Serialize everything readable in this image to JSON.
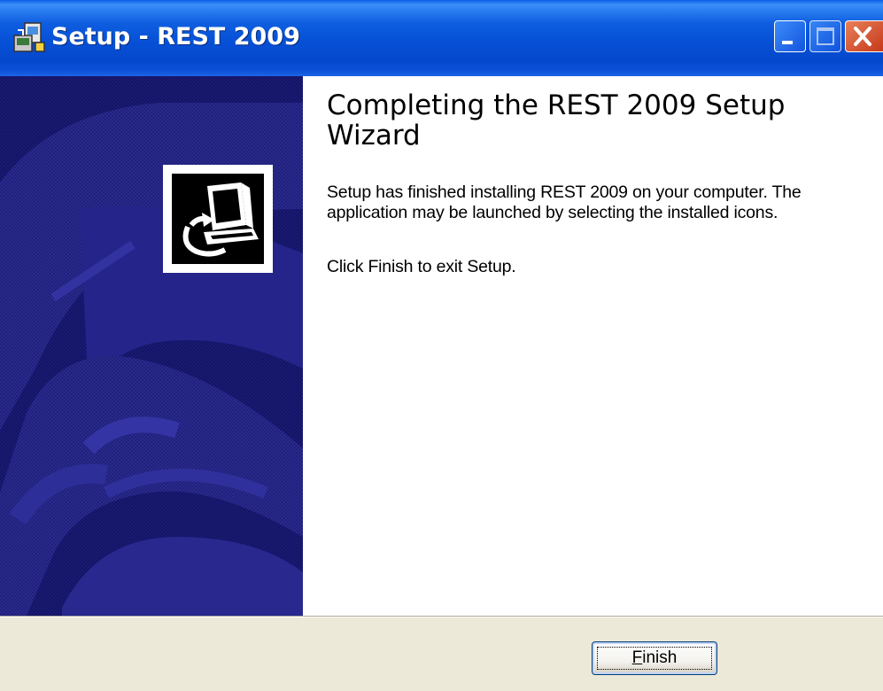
{
  "window": {
    "title": "Setup - REST 2009",
    "icon": "setup-installer-icon",
    "controls": [
      "minimize-icon",
      "maximize-icon",
      "close-icon"
    ]
  },
  "wizard": {
    "heading": "Completing the REST 2009 Setup Wizard",
    "description": "Setup has finished installing REST 2009 on your computer. The application may be launched by selecting the installed icons.",
    "note": "Click Finish to exit Setup.",
    "panel_logo": "computer-install-icon"
  },
  "footer": {
    "finish_accel": "F",
    "finish_rest": "inish"
  },
  "colors": {
    "titlebar": "#0650d6",
    "panel": "#1a1a72",
    "panel_light": "#2e2e9a",
    "dialog_bg": "#ece9d8",
    "close_button": "#c6391a"
  }
}
